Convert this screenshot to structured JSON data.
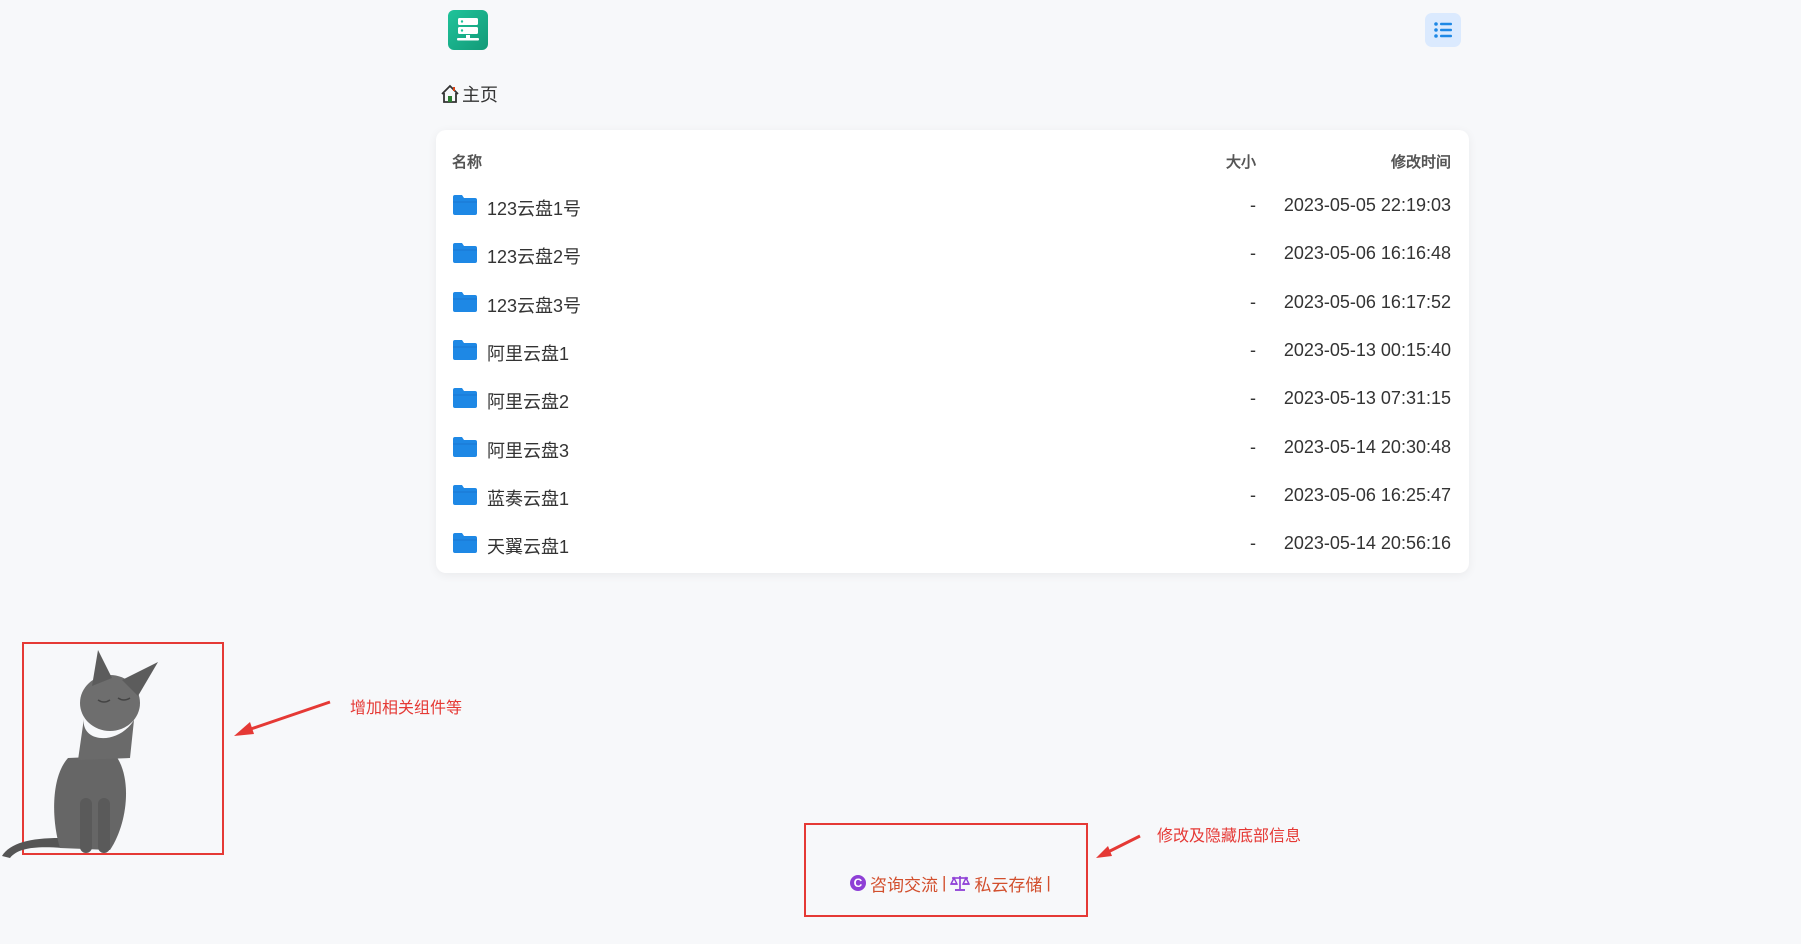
{
  "header": {
    "logo_icon": "server-stack-icon",
    "view_toggle_icon": "list-icon",
    "accent": "#1e88e5"
  },
  "breadcrumb": {
    "icon": "home-icon",
    "label": "主页"
  },
  "table": {
    "columns": {
      "name": "名称",
      "size": "大小",
      "modified": "修改时间"
    },
    "rows": [
      {
        "name": "123云盘1号",
        "size": "-",
        "modified": "2023-05-05 22:19:03"
      },
      {
        "name": "123云盘2号",
        "size": "-",
        "modified": "2023-05-06 16:16:48"
      },
      {
        "name": "123云盘3号",
        "size": "-",
        "modified": "2023-05-06 16:17:52"
      },
      {
        "name": "阿里云盘1",
        "size": "-",
        "modified": "2023-05-13 00:15:40"
      },
      {
        "name": "阿里云盘2",
        "size": "-",
        "modified": "2023-05-13 07:31:15"
      },
      {
        "name": "阿里云盘3",
        "size": "-",
        "modified": "2023-05-14 20:30:48"
      },
      {
        "name": "蓝奏云盘1",
        "size": "-",
        "modified": "2023-05-06 16:25:47"
      },
      {
        "name": "天翼云盘1",
        "size": "-",
        "modified": "2023-05-14 20:56:16"
      }
    ]
  },
  "annotations": {
    "widget_note": "增加相关组件等",
    "footer_note": "修改及隐藏底部信息"
  },
  "footer": {
    "consult_icon": "c-circle-icon",
    "consult_label": "咨询交流",
    "separator": "|",
    "storage_icon": "scales-icon",
    "storage_label": "私云存储",
    "trailing_separator": "|"
  }
}
